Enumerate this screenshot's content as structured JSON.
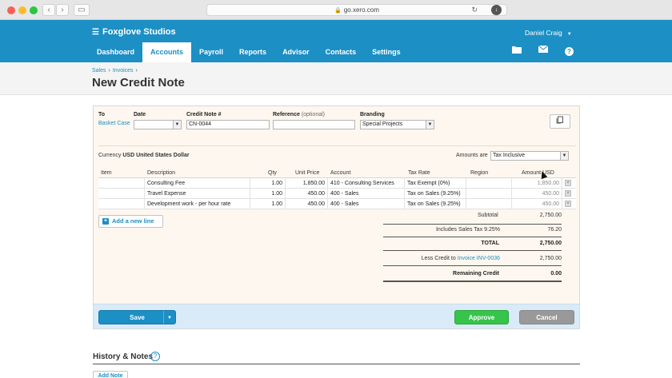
{
  "browser": {
    "url": "go.xero.com"
  },
  "header": {
    "org_name": "Foxglove Studios",
    "user_name": "Daniel Craig",
    "tabs": [
      {
        "label": "Dashboard"
      },
      {
        "label": "Accounts"
      },
      {
        "label": "Payroll"
      },
      {
        "label": "Reports"
      },
      {
        "label": "Advisor"
      },
      {
        "label": "Contacts"
      },
      {
        "label": "Settings"
      }
    ],
    "active_tab": "Accounts",
    "help_label": "?"
  },
  "breadcrumb": {
    "items": [
      "Sales",
      "Invoices"
    ],
    "separator": "›"
  },
  "page": {
    "title": "New Credit Note"
  },
  "form": {
    "to_label": "To",
    "to_value": "Basket Case",
    "date_label": "Date",
    "date_value": "",
    "credit_note_label": "Credit Note #",
    "credit_note_value": "CN-0044",
    "reference_label": "Reference",
    "reference_optional": "(optional)",
    "reference_value": "",
    "branding_label": "Branding",
    "branding_value": "Special Projects",
    "currency_label": "Currency",
    "currency_value": "USD United States Dollar",
    "amounts_are_label": "Amounts are",
    "amounts_are_value": "Tax Inclusive"
  },
  "table": {
    "headers": {
      "item": "Item",
      "description": "Description",
      "qty": "Qty",
      "unit_price": "Unit Price",
      "account": "Account",
      "tax_rate": "Tax Rate",
      "region": "Region",
      "amount": "Amount USD"
    },
    "rows": [
      {
        "item": "",
        "description": "Consulting Fee",
        "qty": "1.00",
        "unit_price": "1,850.00",
        "account": "410 - Consulting Services",
        "tax_rate": "Tax Exempt (0%)",
        "region": "",
        "amount": "1,850.00"
      },
      {
        "item": "",
        "description": "Travel Expense",
        "qty": "1.00",
        "unit_price": "450.00",
        "account": "400 - Sales",
        "tax_rate": "Tax on Sales (9.25%)",
        "region": "",
        "amount": "450.00"
      },
      {
        "item": "",
        "description": "Development work - per hour rate",
        "qty": "1.00",
        "unit_price": "450.00",
        "account": "400 - Sales",
        "tax_rate": "Tax on Sales (9.25%)",
        "region": "",
        "amount": "450.00"
      }
    ],
    "add_line_label": "Add a new line"
  },
  "totals": {
    "subtotal_label": "Subtotal",
    "subtotal_value": "2,750.00",
    "tax_label": "Includes Sales Tax 9.25%",
    "tax_value": "76.20",
    "total_label": "TOTAL",
    "total_value": "2,750.00",
    "less_credit_label": "Less Credit to",
    "less_credit_link": "Invoice INV-0036",
    "less_credit_value": "2,750.00",
    "remaining_label": "Remaining Credit",
    "remaining_value": "0.00"
  },
  "actions": {
    "save_label": "Save",
    "approve_label": "Approve",
    "cancel_label": "Cancel"
  },
  "history": {
    "title": "History & Notes",
    "add_note_label": "Add Note"
  },
  "colors": {
    "brand_blue": "#1c8fc5",
    "approve_green": "#37c44a",
    "cancel_grey": "#999999",
    "panel_bg": "#fdf7ef",
    "footer_bg": "#d9ebf8"
  }
}
